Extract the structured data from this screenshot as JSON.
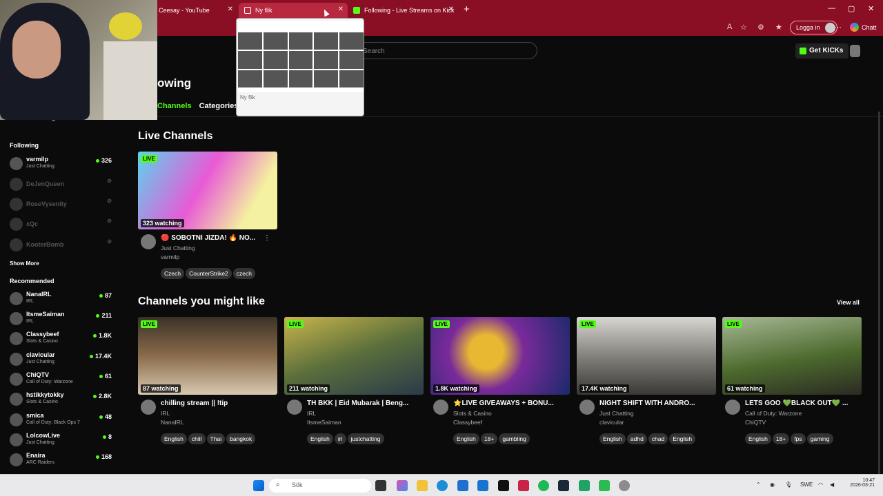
{
  "browser": {
    "tabs": [
      {
        "title": "Ceesay - YouTube"
      },
      {
        "title": "Ny flik"
      },
      {
        "title": "Following - Live Streams on Kick"
      }
    ],
    "new_tab": "+",
    "login_label": "Logga in",
    "chat_label": "Chatt",
    "tab_preview_label": "Ny flik",
    "close_glyph": "✕"
  },
  "header": {
    "search_placeholder": "Search",
    "get_kicks": "Get KICKs"
  },
  "page": {
    "title_partial": "owing",
    "tabs": [
      "Channels",
      "Categories"
    ]
  },
  "sidebar": {
    "collapsed_label": "Following",
    "following_title": "Following",
    "following": [
      {
        "name": "varmilp",
        "category": "Just Chatting",
        "viewers": "326",
        "live": true
      },
      {
        "name": "DeJenQueen",
        "live": false
      },
      {
        "name": "RoseVysenity",
        "live": false
      },
      {
        "name": "xQc",
        "live": false
      },
      {
        "name": "KooterBomb",
        "live": false
      }
    ],
    "show_more": "Show More",
    "recommended_title": "Recommended",
    "recommended": [
      {
        "name": "NanaIRL",
        "category": "IRL",
        "viewers": "87"
      },
      {
        "name": "ItsmeSaiman",
        "category": "IRL",
        "viewers": "211"
      },
      {
        "name": "Classybeef",
        "category": "Slots & Casino",
        "viewers": "1.8K"
      },
      {
        "name": "clavicular",
        "category": "Just Chatting",
        "viewers": "17.4K"
      },
      {
        "name": "ChiQTV",
        "category": "Call of Duty: Warzone",
        "viewers": "61"
      },
      {
        "name": "hstikkytokky",
        "category": "Slots & Casino",
        "viewers": "2.8K"
      },
      {
        "name": "smica",
        "category": "Call of Duty: Black Ops 7",
        "viewers": "48"
      },
      {
        "name": "LolcowLive",
        "category": "Just Chatting",
        "viewers": "8"
      },
      {
        "name": "Enaira",
        "category": "ARC Raiders",
        "viewers": "168"
      }
    ]
  },
  "live_channels": {
    "title": "Live Channels",
    "cards": [
      {
        "live": "LIVE",
        "watching": "323 watching",
        "title": "🔴 SOBOTNÍ JÍZDA! 🔥 NO...",
        "category": "Just Chatting",
        "channel": "varmilp",
        "tags": [
          "Czech",
          "CounterStrike2",
          "czech"
        ],
        "thumb_color": "#e85ad6"
      }
    ]
  },
  "suggested": {
    "title": "Channels you might like",
    "view_all": "View all",
    "cards": [
      {
        "live": "LIVE",
        "watching": "87 watching",
        "title": "chilling stream || !tip",
        "category": "IRL",
        "channel": "NanaIRL",
        "tags": [
          "English",
          "chill",
          "Thai",
          "bangkok"
        ],
        "thumb_color": "#8a6b4a"
      },
      {
        "live": "LIVE",
        "watching": "211 watching",
        "title": "TH BKK | Eid Mubarak | Beng...",
        "category": "IRL",
        "channel": "ItsmeSaiman",
        "tags": [
          "English",
          "irl",
          "justchatting"
        ],
        "thumb_color": "#5a6e3c"
      },
      {
        "live": "LIVE",
        "watching": "1.8K watching",
        "title": "⭐LIVE GIVEAWAYS + BONU...",
        "category": "Slots & Casino",
        "channel": "Classybeef",
        "tags": [
          "English",
          "18+",
          "gambling"
        ],
        "thumb_color": "#7a2a9a"
      },
      {
        "live": "LIVE",
        "watching": "17.4K watching",
        "title": "NIGHT SHIFT WITH ANDRO...",
        "category": "Just Chatting",
        "channel": "clavicular",
        "tags": [
          "English",
          "adhd",
          "chad",
          "English"
        ],
        "thumb_color": "#7c7a74"
      },
      {
        "live": "LIVE",
        "watching": "61 watching",
        "title": "LETS GOO 💚BLACK OUT💚 ...",
        "category": "Call of Duty: Warzone",
        "channel": "ChiQTV",
        "tags": [
          "English",
          "18+",
          "fps",
          "gaming"
        ],
        "thumb_color": "#4d6a2e"
      }
    ]
  },
  "taskbar": {
    "search": "Sök",
    "language": "SWE",
    "time": "10:47",
    "date": "2026-03-21"
  },
  "colors": {
    "accent": "#53fc18",
    "browser_frame": "#8a0f24"
  }
}
